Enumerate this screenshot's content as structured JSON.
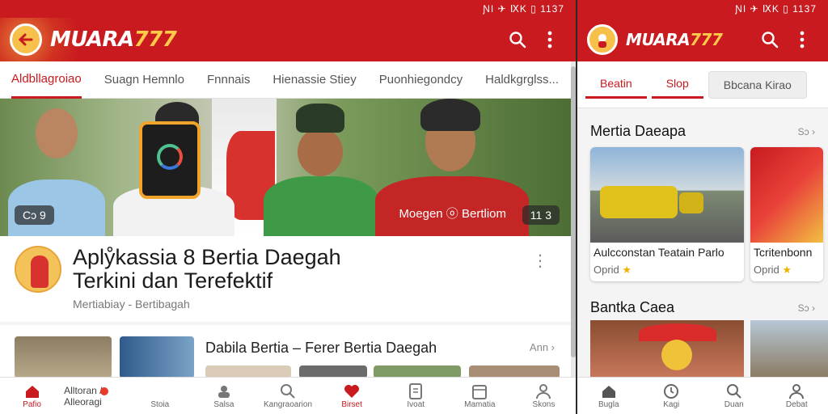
{
  "left": {
    "status": "ƝI ✈ ⅨK ▯ 1137",
    "app_name_white": "MUARA",
    "app_name_gold": "777",
    "tabs": [
      "Aldbllagroiao",
      "Suagn Hemnlo",
      "Fnnnais",
      "Hienassie Stiey",
      "Puonhiegondcy",
      "Haldkgrglss..."
    ],
    "hero": {
      "left_badge": "Cɔ 9",
      "right_badge": "11 3",
      "caption": "Moegen ⓞ Bertliom"
    },
    "article": {
      "headline_line1": "Aplẙkassia 8 Bertia Daegah",
      "headline_line2": "Terkini dan Terefektif",
      "meta": "Mertiabiay - Bertibagah"
    },
    "related": {
      "title": "Dabila Bertia – Ferer Bertia Daegah",
      "more": "Ann ›"
    },
    "nav": [
      "Pafio",
      "Alltoran / Alleoragi",
      "Stoia",
      "Salsa",
      "Kangraoarion",
      "Birset",
      "Ivoat",
      "Mamatia",
      "Skons"
    ]
  },
  "right": {
    "status": "ƝI ✈ ⅨK ▯ 1137",
    "app_name_white": "MUARA",
    "app_name_gold": "777",
    "tabs": [
      "Beatin",
      "Slop",
      "Bbcana Kirao"
    ],
    "section1": {
      "title": "Mertia Daeapa",
      "more": "Sɔ ›",
      "cards": [
        {
          "title": "Aulcconstan Teatain Parlo",
          "sub": "Oprid"
        },
        {
          "title": "Tcritenbonn",
          "sub": "Oprid"
        }
      ]
    },
    "section2": {
      "title": "Bantka Caea",
      "more": "Sɔ ›"
    },
    "nav": [
      "Bugla",
      "Kagi",
      "Duan",
      "Debat"
    ]
  },
  "colors": {
    "brand_red": "#c81a1f",
    "gold": "#ffc94a"
  }
}
